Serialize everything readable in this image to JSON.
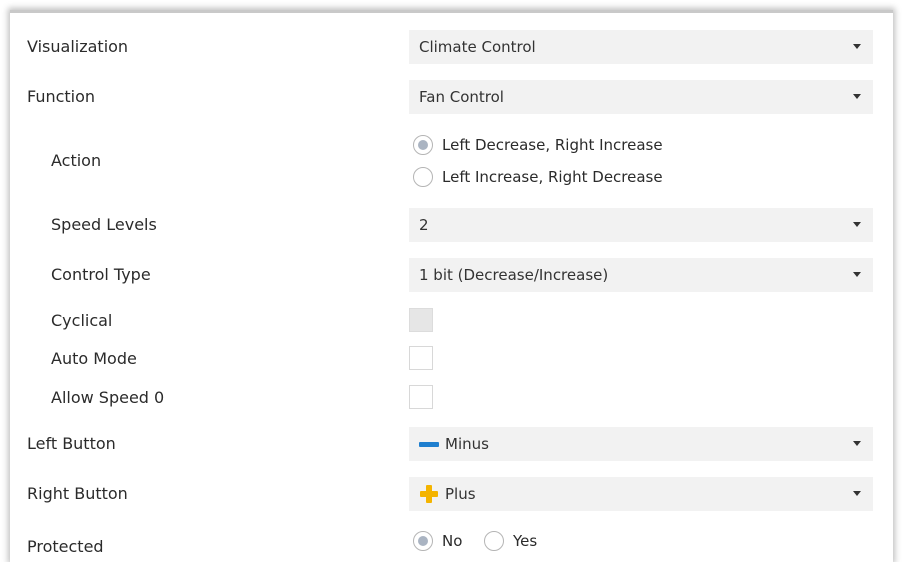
{
  "rows": {
    "visualization": {
      "label": "Visualization",
      "value": "Climate Control"
    },
    "function": {
      "label": "Function",
      "value": "Fan Control"
    },
    "action": {
      "label": "Action",
      "options": [
        "Left Decrease, Right Increase",
        "Left Increase, Right Decrease"
      ],
      "selected": "Left Decrease, Right Increase"
    },
    "speed_levels": {
      "label": "Speed Levels",
      "value": "2"
    },
    "control_type": {
      "label": "Control Type",
      "value": "1 bit (Decrease/Increase)"
    },
    "cyclical": {
      "label": "Cyclical",
      "checked": false,
      "disabled": true
    },
    "auto_mode": {
      "label": "Auto Mode",
      "checked": false
    },
    "allow_speed_0": {
      "label": "Allow Speed 0",
      "checked": false
    },
    "left_button": {
      "label": "Left Button",
      "value": "Minus",
      "icon": "minus-icon"
    },
    "right_button": {
      "label": "Right Button",
      "value": "Plus",
      "icon": "plus-icon"
    },
    "protected": {
      "label": "Protected",
      "options": [
        "No",
        "Yes"
      ],
      "selected": "No"
    }
  },
  "colors": {
    "minus_icon": "#1f7fcf",
    "plus_icon": "#f4b400",
    "dropdown_bg": "#f2f2f2",
    "radio_dot": "#aab4c2"
  }
}
